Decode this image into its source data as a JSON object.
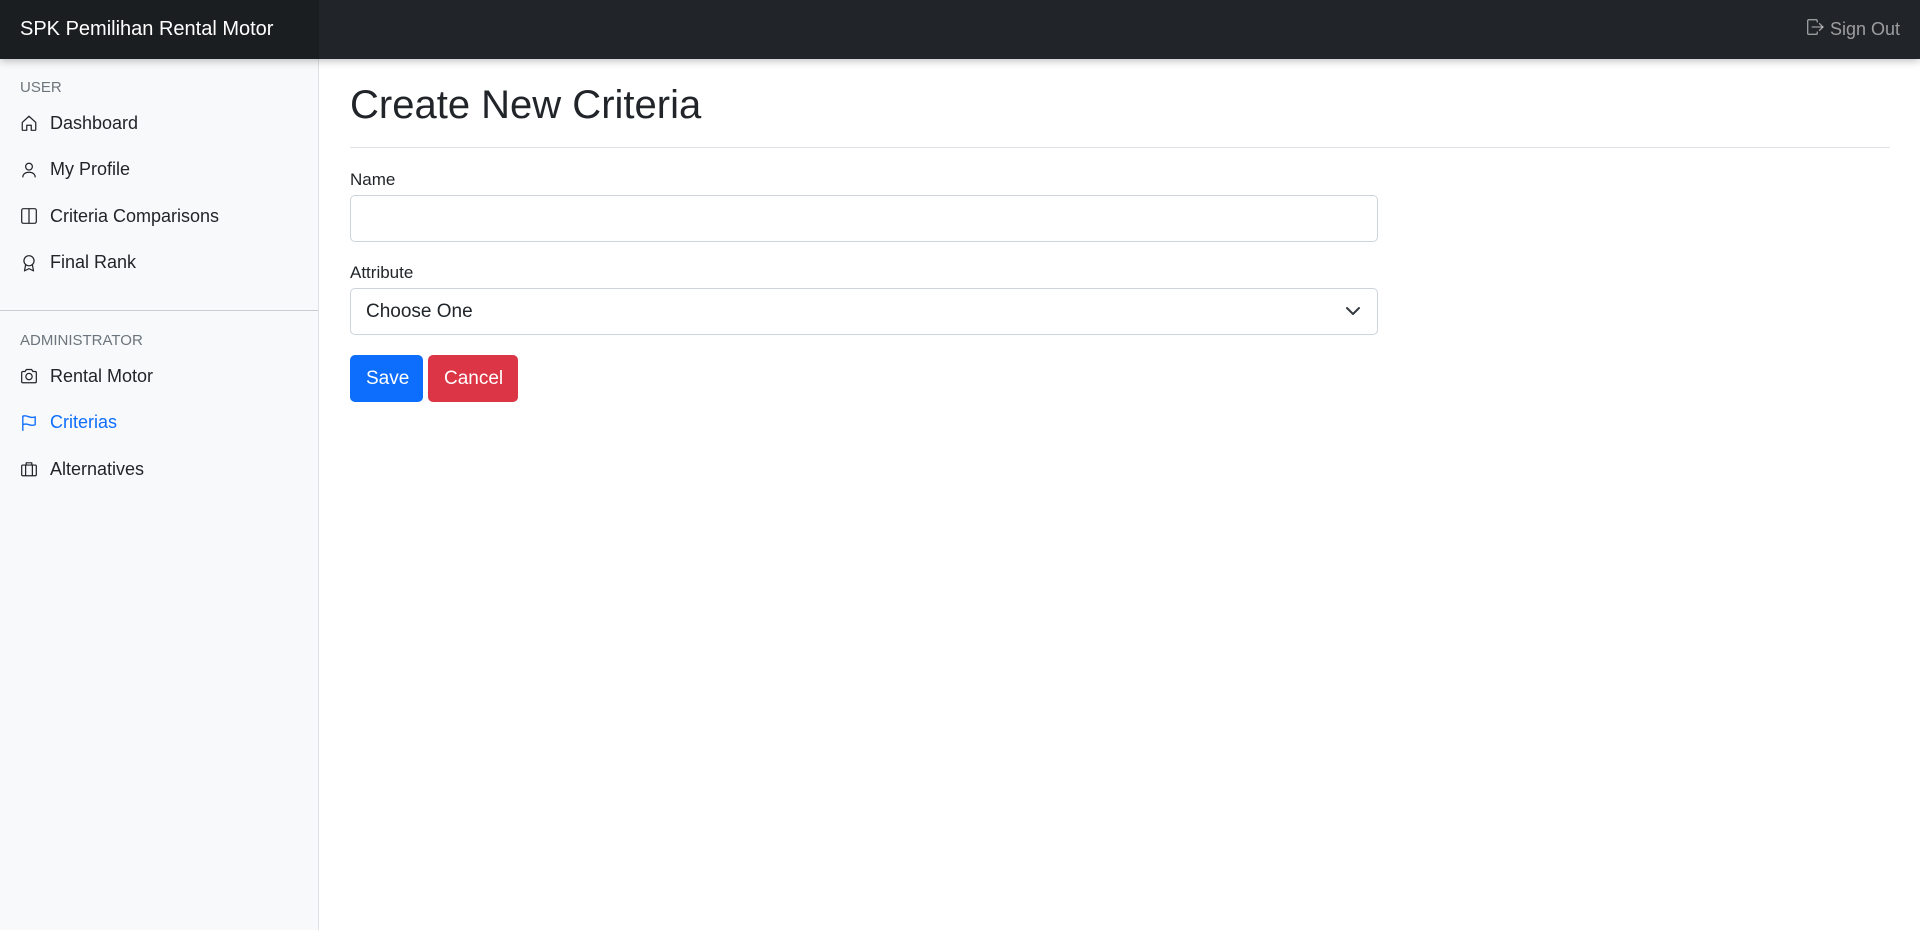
{
  "navbar": {
    "brand": "SPK Pemilihan Rental Motor",
    "signout_label": "Sign Out",
    "signout_icon": "box-arrow-right-icon"
  },
  "sidebar": {
    "user_heading": "USER",
    "user_items": [
      {
        "label": "Dashboard",
        "icon": "house-icon"
      },
      {
        "label": "My Profile",
        "icon": "person-icon"
      },
      {
        "label": "Criteria Comparisons",
        "icon": "layout-split-icon"
      },
      {
        "label": "Final Rank",
        "icon": "award-icon"
      }
    ],
    "admin_heading": "ADMINISTRATOR",
    "admin_items": [
      {
        "label": "Rental Motor",
        "icon": "camera-icon"
      },
      {
        "label": "Criterias",
        "icon": "flag-icon",
        "active": true
      },
      {
        "label": "Alternatives",
        "icon": "briefcase-icon"
      }
    ]
  },
  "main": {
    "title": "Create New Criteria",
    "form": {
      "name_label": "Name",
      "name_value": "",
      "attribute_label": "Attribute",
      "attribute_selected": "Choose One",
      "save_label": "Save",
      "cancel_label": "Cancel"
    }
  },
  "colors": {
    "navbar_bg": "#212529",
    "brand_bg": "#1b1e21",
    "sidebar_bg": "#f8f9fa",
    "active_link": "#0d6efd",
    "save_button": "#0d6efd",
    "cancel_button": "#dc3545"
  }
}
